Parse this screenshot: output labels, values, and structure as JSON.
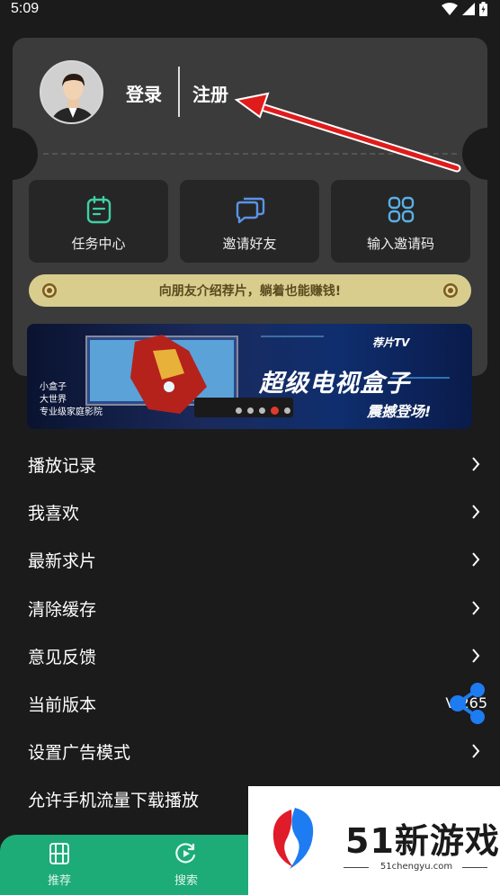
{
  "status_bar": {
    "time": "5:09",
    "icons": [
      "wifi-icon",
      "signal-icon",
      "battery-icon"
    ]
  },
  "profile": {
    "login_label": "登录",
    "register_label": "注册"
  },
  "quick_actions": [
    {
      "icon": "task-icon",
      "label": "任务中心"
    },
    {
      "icon": "invite-chat-icon",
      "label": "邀请好友"
    },
    {
      "icon": "code-grid-icon",
      "label": "输入邀请码"
    }
  ],
  "promo_bar": {
    "text": "向朋友介绍荐片，躺着也能赚钱!"
  },
  "banner": {
    "side_lines": [
      "小盒子",
      "大世界",
      "专业级家庭影院"
    ],
    "brand": "荐片TV",
    "headline": "超级电视盒子",
    "subline": "震撼登场!",
    "slide_count": 5,
    "active_slide": 4
  },
  "menu": [
    {
      "label": "播放记录"
    },
    {
      "label": "我喜欢"
    },
    {
      "label": "最新求片"
    },
    {
      "label": "清除缓存"
    },
    {
      "label": "意见反馈"
    },
    {
      "label": "当前版本",
      "value": "V 265"
    },
    {
      "label": "设置广告模式"
    },
    {
      "label": "允许手机流量下载播放"
    }
  ],
  "bottom_nav": [
    {
      "icon": "film-icon",
      "label": "推荐"
    },
    {
      "icon": "search-refresh-icon",
      "label": "搜索"
    }
  ],
  "watermark": {
    "text": "51新游戏",
    "url": "51chengyu.com"
  },
  "colors": {
    "accent_green": "#1dab77",
    "promo_gold": "#d9cd8e",
    "card_bg": "#3b3b3b",
    "tile_bg": "#262626",
    "icon_teal": "#3fd1a4",
    "icon_blue": "#5a93e8",
    "arrow_red": "#e01b1b",
    "share_blue": "#1e7cf2"
  }
}
